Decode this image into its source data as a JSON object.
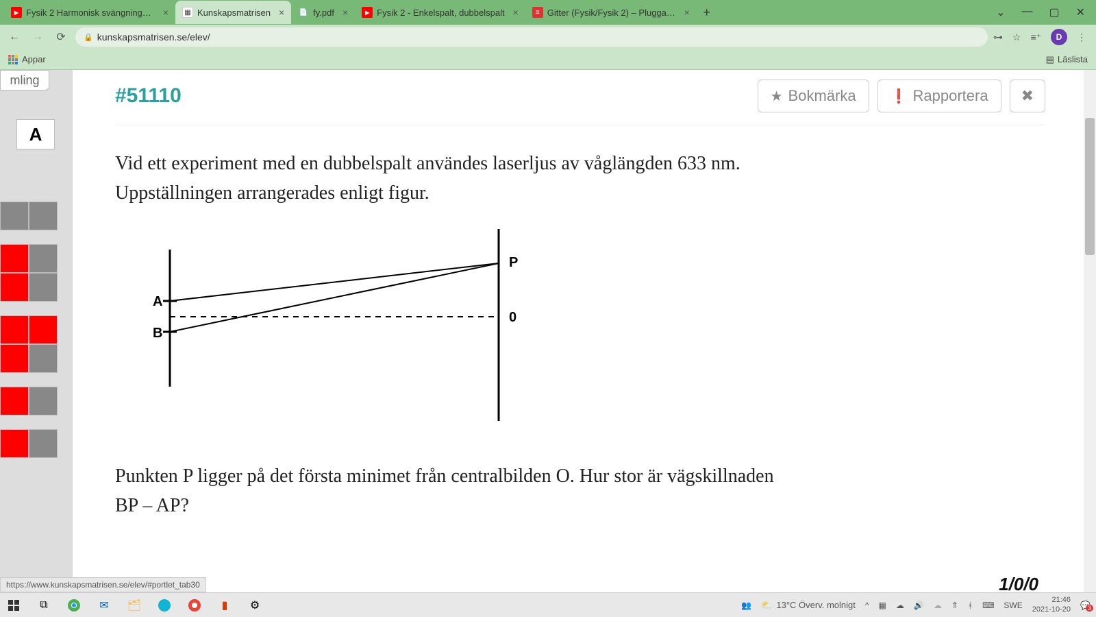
{
  "browser": {
    "tabs": [
      {
        "label": "Fysik 2 Harmonisk svängningsrör"
      },
      {
        "label": "Kunskapsmatrisen"
      },
      {
        "label": "fy.pdf"
      },
      {
        "label": "Fysik 2 - Enkelspalt, dubbelspalt"
      },
      {
        "label": "Gitter (Fysik/Fysik 2) – Pluggakut"
      }
    ],
    "url": "kunskapsmatrisen.se/elev/",
    "apps_label": "Appar",
    "reading_list": "Läslista",
    "avatar": "D"
  },
  "sidebar": {
    "partial": "mling",
    "big_letter": "A"
  },
  "question": {
    "id": "#51110",
    "bookmark_label": "Bokmärka",
    "report_label": "Rapportera",
    "para1": "Vid ett experiment med en dubbelspalt användes laserljus av våglängden 633 nm. Uppställningen arrangerades enligt figur.",
    "para2": "Punkten P ligger på det första minimet från centralbilden O. Hur stor är vägskillnaden BP – AP?",
    "diagram_labels": {
      "A": "A",
      "B": "B",
      "P": "P",
      "O": "0"
    },
    "footer_num": "1/0/0"
  },
  "status_url": "https://www.kunskapsmatrisen.se/elev/#portlet_tab30",
  "taskbar": {
    "weather": "13°C Överv. molnigt",
    "lang": "SWE",
    "time": "21:46",
    "date": "2021-10-20",
    "notif": "3"
  }
}
